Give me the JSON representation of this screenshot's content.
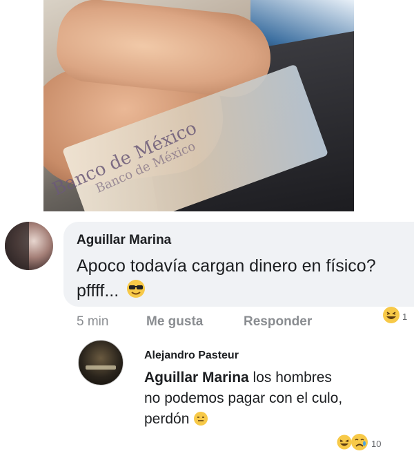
{
  "photo": {
    "bill_text_main": "Banco de México",
    "bill_text_secondary": "Banco de México"
  },
  "comment": {
    "author": "Aguillar Marina",
    "text": "Apoco todavía cargan dinero en físico? pffff...",
    "emoji_icon": "sunglasses-face-icon",
    "time": "5 min",
    "like_label": "Me gusta",
    "reply_label": "Responder",
    "reaction_icon": "laughing-face-icon",
    "reaction_count": "1"
  },
  "reply": {
    "author": "Alejandro Pasteur",
    "mention": "Aguillar Marina",
    "text_after_mention": " los hombres no podemos pagar con el culo, perdón",
    "emoji_icon": "sweat-smile-icon",
    "reaction_icons": [
      "laughing-face-icon",
      "crying-face-icon"
    ],
    "reaction_count": "10"
  },
  "colors": {
    "bubble": "#f0f2f5",
    "meta_text": "#8a8d91",
    "emoji_yellow": "#f7c948"
  }
}
